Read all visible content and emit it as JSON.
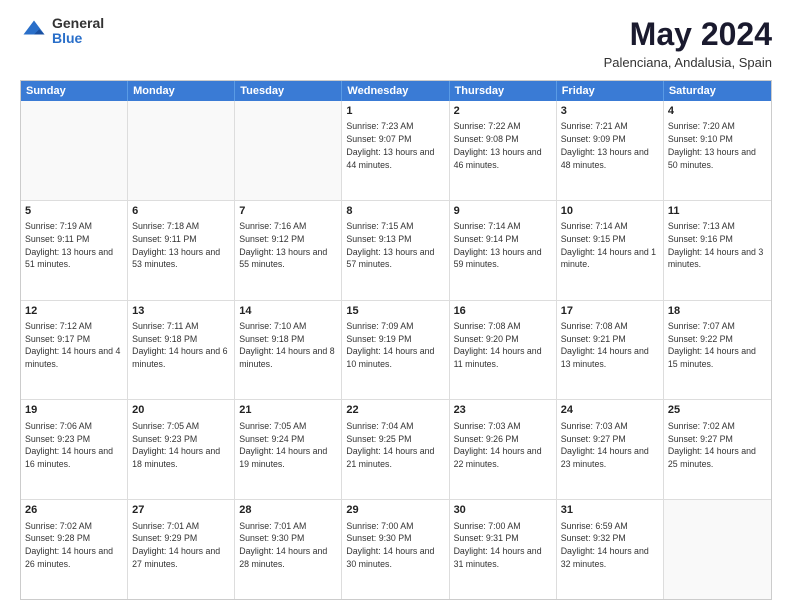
{
  "header": {
    "logo": {
      "general": "General",
      "blue": "Blue"
    },
    "title": "May 2024",
    "location": "Palenciana, Andalusia, Spain"
  },
  "weekdays": [
    "Sunday",
    "Monday",
    "Tuesday",
    "Wednesday",
    "Thursday",
    "Friday",
    "Saturday"
  ],
  "rows": [
    [
      {
        "day": "",
        "empty": true
      },
      {
        "day": "",
        "empty": true
      },
      {
        "day": "",
        "empty": true
      },
      {
        "day": "1",
        "sunrise": "7:23 AM",
        "sunset": "9:07 PM",
        "daylight": "13 hours and 44 minutes."
      },
      {
        "day": "2",
        "sunrise": "7:22 AM",
        "sunset": "9:08 PM",
        "daylight": "13 hours and 46 minutes."
      },
      {
        "day": "3",
        "sunrise": "7:21 AM",
        "sunset": "9:09 PM",
        "daylight": "13 hours and 48 minutes."
      },
      {
        "day": "4",
        "sunrise": "7:20 AM",
        "sunset": "9:10 PM",
        "daylight": "13 hours and 50 minutes."
      }
    ],
    [
      {
        "day": "5",
        "sunrise": "7:19 AM",
        "sunset": "9:11 PM",
        "daylight": "13 hours and 51 minutes."
      },
      {
        "day": "6",
        "sunrise": "7:18 AM",
        "sunset": "9:11 PM",
        "daylight": "13 hours and 53 minutes."
      },
      {
        "day": "7",
        "sunrise": "7:16 AM",
        "sunset": "9:12 PM",
        "daylight": "13 hours and 55 minutes."
      },
      {
        "day": "8",
        "sunrise": "7:15 AM",
        "sunset": "9:13 PM",
        "daylight": "13 hours and 57 minutes."
      },
      {
        "day": "9",
        "sunrise": "7:14 AM",
        "sunset": "9:14 PM",
        "daylight": "13 hours and 59 minutes."
      },
      {
        "day": "10",
        "sunrise": "7:14 AM",
        "sunset": "9:15 PM",
        "daylight": "14 hours and 1 minute."
      },
      {
        "day": "11",
        "sunrise": "7:13 AM",
        "sunset": "9:16 PM",
        "daylight": "14 hours and 3 minutes."
      }
    ],
    [
      {
        "day": "12",
        "sunrise": "7:12 AM",
        "sunset": "9:17 PM",
        "daylight": "14 hours and 4 minutes."
      },
      {
        "day": "13",
        "sunrise": "7:11 AM",
        "sunset": "9:18 PM",
        "daylight": "14 hours and 6 minutes."
      },
      {
        "day": "14",
        "sunrise": "7:10 AM",
        "sunset": "9:18 PM",
        "daylight": "14 hours and 8 minutes."
      },
      {
        "day": "15",
        "sunrise": "7:09 AM",
        "sunset": "9:19 PM",
        "daylight": "14 hours and 10 minutes."
      },
      {
        "day": "16",
        "sunrise": "7:08 AM",
        "sunset": "9:20 PM",
        "daylight": "14 hours and 11 minutes."
      },
      {
        "day": "17",
        "sunrise": "7:08 AM",
        "sunset": "9:21 PM",
        "daylight": "14 hours and 13 minutes."
      },
      {
        "day": "18",
        "sunrise": "7:07 AM",
        "sunset": "9:22 PM",
        "daylight": "14 hours and 15 minutes."
      }
    ],
    [
      {
        "day": "19",
        "sunrise": "7:06 AM",
        "sunset": "9:23 PM",
        "daylight": "14 hours and 16 minutes."
      },
      {
        "day": "20",
        "sunrise": "7:05 AM",
        "sunset": "9:23 PM",
        "daylight": "14 hours and 18 minutes."
      },
      {
        "day": "21",
        "sunrise": "7:05 AM",
        "sunset": "9:24 PM",
        "daylight": "14 hours and 19 minutes."
      },
      {
        "day": "22",
        "sunrise": "7:04 AM",
        "sunset": "9:25 PM",
        "daylight": "14 hours and 21 minutes."
      },
      {
        "day": "23",
        "sunrise": "7:03 AM",
        "sunset": "9:26 PM",
        "daylight": "14 hours and 22 minutes."
      },
      {
        "day": "24",
        "sunrise": "7:03 AM",
        "sunset": "9:27 PM",
        "daylight": "14 hours and 23 minutes."
      },
      {
        "day": "25",
        "sunrise": "7:02 AM",
        "sunset": "9:27 PM",
        "daylight": "14 hours and 25 minutes."
      }
    ],
    [
      {
        "day": "26",
        "sunrise": "7:02 AM",
        "sunset": "9:28 PM",
        "daylight": "14 hours and 26 minutes."
      },
      {
        "day": "27",
        "sunrise": "7:01 AM",
        "sunset": "9:29 PM",
        "daylight": "14 hours and 27 minutes."
      },
      {
        "day": "28",
        "sunrise": "7:01 AM",
        "sunset": "9:30 PM",
        "daylight": "14 hours and 28 minutes."
      },
      {
        "day": "29",
        "sunrise": "7:00 AM",
        "sunset": "9:30 PM",
        "daylight": "14 hours and 30 minutes."
      },
      {
        "day": "30",
        "sunrise": "7:00 AM",
        "sunset": "9:31 PM",
        "daylight": "14 hours and 31 minutes."
      },
      {
        "day": "31",
        "sunrise": "6:59 AM",
        "sunset": "9:32 PM",
        "daylight": "14 hours and 32 minutes."
      },
      {
        "day": "",
        "empty": true
      }
    ]
  ]
}
